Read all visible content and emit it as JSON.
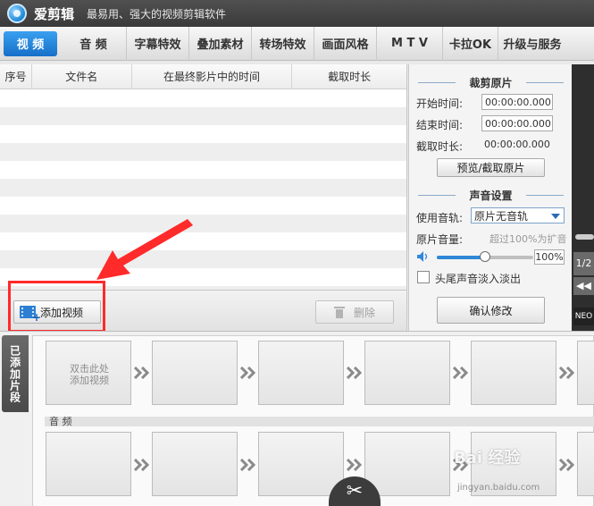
{
  "titlebar": {
    "app_name": "爱剪辑",
    "slogan": "最易用、强大的视频剪辑软件"
  },
  "tabs": [
    {
      "label": "视 频",
      "active": true
    },
    {
      "label": "音 频"
    },
    {
      "label": "字幕特效"
    },
    {
      "label": "叠加素材"
    },
    {
      "label": "转场特效"
    },
    {
      "label": "画面风格"
    },
    {
      "label": "M T V"
    },
    {
      "label": "卡拉OK"
    },
    {
      "label": "升级与服务"
    }
  ],
  "list": {
    "columns": [
      "序号",
      "文件名",
      "在最终影片中的时间",
      "截取时长"
    ]
  },
  "actions": {
    "add_video": "添加视频",
    "delete": "删除"
  },
  "trim": {
    "title": "裁剪原片",
    "start_label": "开始时间:",
    "start_value": "00:00:00.000",
    "end_label": "结束时间:",
    "end_value": "00:00:00.000",
    "duration_label": "截取时长:",
    "duration_value": "00:00:00.000",
    "preview_button": "预览/截取原片"
  },
  "audio": {
    "title": "声音设置",
    "track_label": "使用音轨:",
    "track_value": "原片无音轨",
    "volume_label": "原片音量:",
    "volume_hint": "超过100%为扩音",
    "volume_value": "100%",
    "volume_level": 0.5,
    "fade_label": "头尾声音淡入淡出",
    "confirm_button": "确认修改"
  },
  "preview": {
    "page": "1/2",
    "brand": "NEO"
  },
  "clips": {
    "side_tab": "已添加片段",
    "placeholder_line1": "双击此处",
    "placeholder_line2": "添加视频",
    "audio_label": "音 频"
  },
  "watermark": {
    "main": "Bai 经验",
    "sub": "jingyan.baidu.com"
  },
  "colors": {
    "accent": "#1670c8",
    "annotation": "#ff2a2a"
  },
  "icons": [
    "logo-icon",
    "film-add-icon",
    "trash-icon",
    "speaker-icon",
    "chevron-right-icon",
    "scissors-icon",
    "rewind-icon"
  ]
}
